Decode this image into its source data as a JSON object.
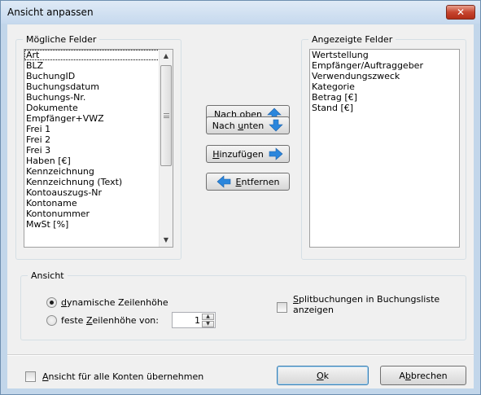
{
  "window": {
    "title": "Ansicht anpassen",
    "close_glyph": "✕"
  },
  "available_fields": {
    "legend": "Mögliche Felder",
    "items": [
      "Art",
      "BLZ",
      "BuchungID",
      "Buchungsdatum",
      "Buchungs-Nr.",
      "Dokumente",
      "Empfänger+VWZ",
      "Frei 1",
      "Frei 2",
      "Frei 3",
      "Haben [€]",
      "Kennzeichnung",
      "Kennzeichnung (Text)",
      "Kontoauszugs-Nr",
      "Kontoname",
      "Kontonummer",
      "MwSt [%]"
    ],
    "selected_index": 0
  },
  "displayed_fields": {
    "legend": "Angezeigte Felder",
    "items": [
      "Wertstellung",
      "Empfänger/Auftraggeber",
      "Verwendungszweck",
      "Kategorie",
      "Betrag [€]",
      "Stand [€]"
    ]
  },
  "buttons": {
    "move_up": {
      "before": "",
      "accel": "N",
      "after": "ach oben"
    },
    "move_down": {
      "before": "Nach ",
      "accel": "u",
      "after": "nten"
    },
    "add": {
      "before": "",
      "accel": "H",
      "after": "inzufügen"
    },
    "remove": {
      "before": "",
      "accel": "E",
      "after": "ntfernen"
    },
    "ok": {
      "before": "",
      "accel": "O",
      "after": "k"
    },
    "cancel": {
      "before": "A",
      "accel": "b",
      "after": "brechen"
    }
  },
  "view": {
    "legend": "Ansicht",
    "dynamic_row_height": {
      "accel": "d",
      "rest": "ynamische Zeilenhöhe",
      "checked": true
    },
    "fixed_row_height": {
      "before": "feste ",
      "accel": "Z",
      "after": "eilenhöhe von:",
      "checked": false
    },
    "row_height_value": "1",
    "split_bookings": {
      "accel": "S",
      "line1_rest": "plitbuchungen in Buchungsliste",
      "line2": "anzeigen",
      "checked": false
    }
  },
  "apply_all": {
    "accel": "A",
    "rest": "nsicht für alle Konten übernehmen",
    "checked": false
  },
  "colors": {
    "arrow_blue": "#2b86dc",
    "titlebar": "#c6d9ee",
    "close_red": "#c7452f"
  },
  "icons": {
    "move_up": "arrow-up-icon",
    "move_down": "arrow-down-icon",
    "add": "arrow-right-icon",
    "remove": "arrow-left-icon"
  }
}
